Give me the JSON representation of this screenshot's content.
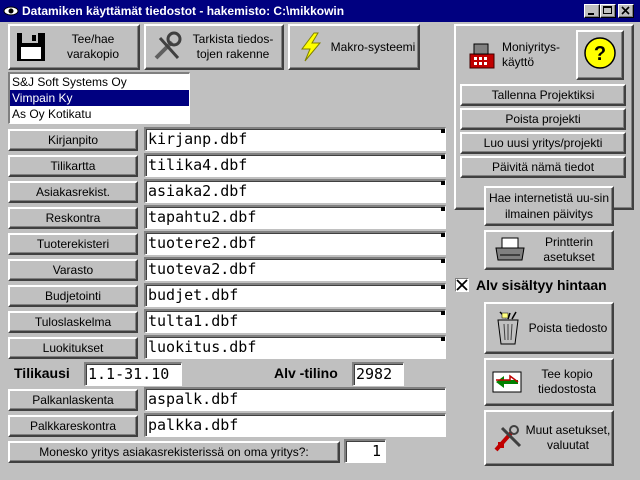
{
  "window": {
    "title": "Datamiken käyttämät tiedostot - hakemisto: C:\\mikkowin"
  },
  "toolbar": {
    "save_label": "Tee/hae varakopio",
    "check_label": "Tarkista tiedos-tojen rakenne",
    "macro_label": "Makro-systeemi"
  },
  "companies": [
    "S&J Soft Systems Oy",
    "Vimpain Ky",
    "As Oy Kotikatu"
  ],
  "selected_company": "Vimpain Ky",
  "files": [
    {
      "label": "Kirjanpito",
      "value": "kirjanp.dbf"
    },
    {
      "label": "Tilikartta",
      "value": "tilika4.dbf"
    },
    {
      "label": "Asiakasrekist.",
      "value": "asiaka2.dbf"
    },
    {
      "label": "Reskontra",
      "value": "tapahtu2.dbf"
    },
    {
      "label": "Tuoterekisteri",
      "value": "tuotere2.dbf"
    },
    {
      "label": "Varasto",
      "value": "tuoteva2.dbf"
    },
    {
      "label": "Budjetointi",
      "value": "budjet.dbf"
    },
    {
      "label": "Tuloslaskelma",
      "value": "tulta1.dbf"
    },
    {
      "label": "Luokitukset",
      "value": "luokitus.dbf"
    }
  ],
  "tilikausi": {
    "label": "Tilikausi",
    "value": "1.1-31.10"
  },
  "alv_tilino": {
    "label": "Alv -tilino",
    "value": "2982"
  },
  "salary_files": [
    {
      "label": "Palkanlaskenta",
      "value": "aspalk.dbf"
    },
    {
      "label": "Palkkareskontra",
      "value": "palkka.dbf"
    }
  ],
  "company_number": {
    "label": "Monesko yritys asiakasrekisterissä on oma yritys?:",
    "value": "1"
  },
  "right_panel": {
    "multi_company_label": "Moniyritys-käyttö",
    "help_label": "?",
    "save_project": "Tallenna Projektiksi",
    "delete_project": "Poista projekti",
    "new_company": "Luo uusi yritys/projekti",
    "update_info": "Päivitä nämä tiedot",
    "internet_update": "Hae internetistä uu-sin ilmainen päivitys",
    "printer_settings": "Printterin asetukset",
    "vat_included_label": "Alv sisältyy hintaan",
    "vat_included": true,
    "delete_file": "Poista tiedosto",
    "copy_file": "Tee kopio tiedostosta",
    "other_settings": "Muut asetukset, valuutat"
  },
  "colors": {
    "titlebar": "#000080",
    "face": "#c0c0c0",
    "selection": "#000080"
  }
}
